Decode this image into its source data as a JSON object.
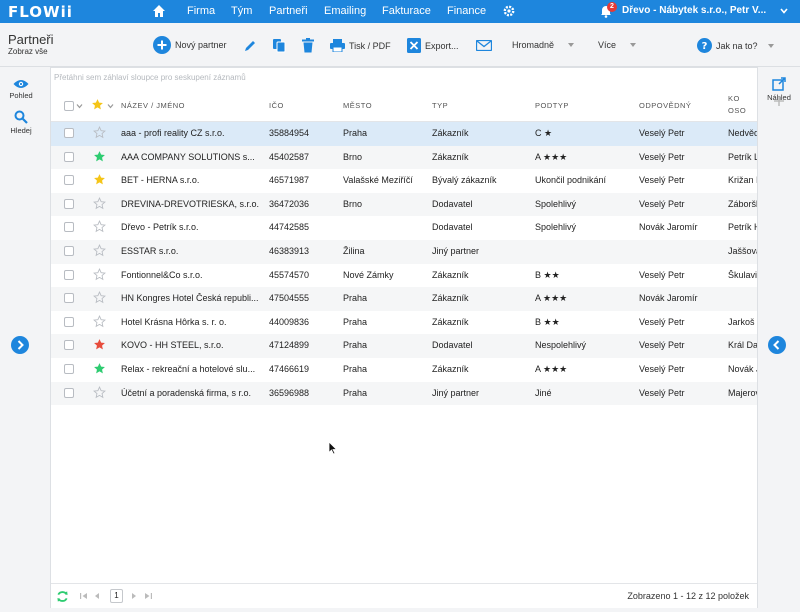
{
  "nav": {
    "logo": "FLOWii",
    "links": [
      "Firma",
      "Tým",
      "Partneři",
      "Emailing",
      "Fakturace",
      "Finance"
    ],
    "notifications": "2",
    "company": "Dřevo - Nábytek s.r.o., Petr V..."
  },
  "toolbar": {
    "title": "Partneři",
    "subtitle": "Zobraz vše",
    "new_partner": "Nový partner",
    "print": "Tisk / PDF",
    "export": "Export...",
    "bulk": "Hromadně",
    "more": "Více",
    "help": "Jak na to?"
  },
  "sidebar": {
    "view": "Pohled",
    "search": "Hledej"
  },
  "rightbar": {
    "preview": "Náhled"
  },
  "grid": {
    "group_hint": "Přetáhni sem záhlaví sloupce pro seskupení záznamů",
    "columns": [
      "NÁZEV / JMÉNO",
      "IČO",
      "MĚSTO",
      "TYP",
      "PODTYP",
      "ODPOVĚDNÝ",
      "KO",
      "OSO"
    ],
    "rows": [
      {
        "star": "none",
        "name": "aaa - profi reality CZ s.r.o.",
        "ico": "35884954",
        "city": "Praha",
        "type": "Zákazník",
        "subtype": "C ★",
        "resp": "Veselý Petr",
        "contact": "Nedvěd",
        "selected": true
      },
      {
        "star": "green",
        "name": "AAA COMPANY SOLUTIONS s...",
        "ico": "45402587",
        "city": "Brno",
        "type": "Zákazník",
        "subtype": "A ★★★",
        "resp": "Veselý Petr",
        "contact": "Petrík L"
      },
      {
        "star": "yellow",
        "name": "BET - HERNA s.r.o.",
        "ico": "46571987",
        "city": "Valašské Meziříčí",
        "type": "Bývalý zákazník",
        "subtype": "Ukončil podnikání",
        "resp": "Veselý Petr",
        "contact": "Križan I"
      },
      {
        "star": "none",
        "name": "DREVINA-DREVOTRIESKA, s.r.o.",
        "ico": "36472036",
        "city": "Brno",
        "type": "Dodavatel",
        "subtype": "Spolehlivý",
        "resp": "Veselý Petr",
        "contact": "Záboršl"
      },
      {
        "star": "none",
        "name": "Dřevo - Petrík s.r.o.",
        "ico": "44742585",
        "city": "",
        "type": "Dodavatel",
        "subtype": "Spolehlivý",
        "resp": "Novák Jaromír",
        "contact": "Petrík H"
      },
      {
        "star": "none",
        "name": "ESSTAR s.r.o.",
        "ico": "46383913",
        "city": "Žilina",
        "type": "Jiný partner",
        "subtype": "",
        "resp": "",
        "contact": "Jaššová"
      },
      {
        "star": "none",
        "name": "Fontionnel&Co s.r.o.",
        "ico": "45574570",
        "city": "Nové Zámky",
        "type": "Zákazník",
        "subtype": "B ★★",
        "resp": "Veselý Petr",
        "contact": "Škulavi"
      },
      {
        "star": "none",
        "name": "HN Kongres Hotel Česká republi...",
        "ico": "47504555",
        "city": "Praha",
        "type": "Zákazník",
        "subtype": "A ★★★",
        "resp": "Novák Jaromír",
        "contact": ""
      },
      {
        "star": "none",
        "name": "Hotel Krásna Hôrka s. r. o.",
        "ico": "44009836",
        "city": "Praha",
        "type": "Zákazník",
        "subtype": "B ★★",
        "resp": "Veselý Petr",
        "contact": "Jarkoš"
      },
      {
        "star": "red",
        "name": "KOVO - HH STEEL, s.r.o.",
        "ico": "47124899",
        "city": "Praha",
        "type": "Dodavatel",
        "subtype": "Nespolehlivý",
        "resp": "Veselý Petr",
        "contact": "Král Da"
      },
      {
        "star": "green",
        "name": "Relax - rekreační a hotelové slu...",
        "ico": "47466619",
        "city": "Praha",
        "type": "Zákazník",
        "subtype": "A ★★★",
        "resp": "Veselý Petr",
        "contact": "Novák J"
      },
      {
        "star": "none",
        "name": "Účetní a poradenská firma, s r.o.",
        "ico": "36596988",
        "city": "Praha",
        "type": "Jiný partner",
        "subtype": "Jiné",
        "resp": "Veselý Petr",
        "contact": "Majerov"
      }
    ]
  },
  "footer": {
    "page": "1",
    "info": "Zobrazeno 1 - 12 z 12 položek"
  },
  "colors": {
    "brand": "#1e86dd",
    "star_green": "#2ecc71",
    "star_yellow": "#f5c518",
    "star_red": "#e74c3c",
    "selected_row": "#dbeaf8"
  }
}
